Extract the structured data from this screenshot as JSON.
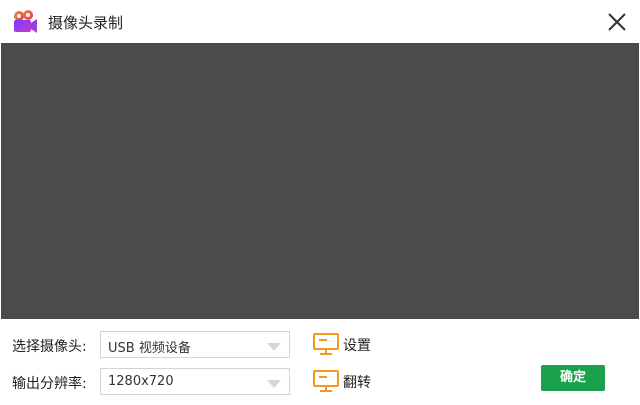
{
  "window": {
    "title": "摄像头录制",
    "app_icon": "camera-recorder-icon",
    "close_icon": "close-icon"
  },
  "preview": {
    "background_color": "#4b4b4b"
  },
  "camera_select": {
    "label": "选择摄像头:",
    "value": "USB 视频设备"
  },
  "output_resolution": {
    "label": "输出分辨率:",
    "value": "1280x720"
  },
  "settings_button": {
    "label": "设置",
    "icon": "monitor-icon"
  },
  "flip_button": {
    "label": "翻转",
    "icon": "monitor-icon"
  },
  "confirm_button": {
    "label": "确定",
    "color": "#19a14b"
  },
  "colors": {
    "accent_icon": "#f39a1e"
  }
}
